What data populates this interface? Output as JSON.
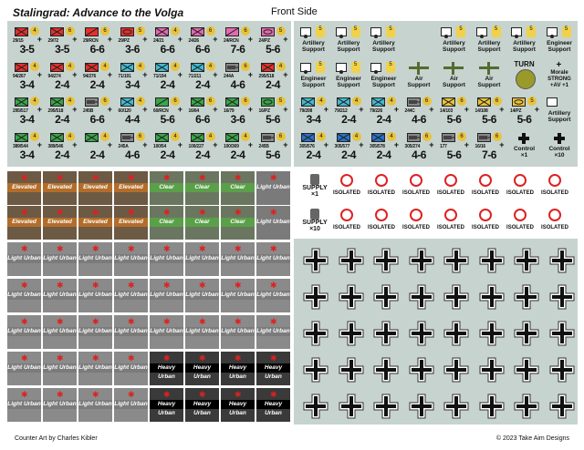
{
  "header": {
    "title": "Stalingrad: Advance to the Volga",
    "subtitle": "Front Side"
  },
  "footer": {
    "left": "Counter Art by Charles Kibler",
    "right": "© 2023 Take Aim Designs"
  },
  "colors": {
    "panel": "#c7d3cf",
    "red": "#e6302b",
    "green": "#3aa64a",
    "cyan": "#43bbd0",
    "pink": "#e46ab0",
    "tan": "#c9a45a",
    "grey": "#888888",
    "blue": "#2a72c8",
    "brown": "#b36d2a"
  },
  "units": [
    {
      "id": "29/15",
      "val": "3-5",
      "badge": "4",
      "color": "#e6302b",
      "sym": "inf"
    },
    {
      "id": "29/72",
      "val": "3-5",
      "badge": "6",
      "color": "#e6302b",
      "sym": "inf"
    },
    {
      "id": "29/RCN",
      "val": "6-6",
      "badge": "6",
      "color": "#e6302b",
      "sym": "rcn"
    },
    {
      "id": "29/PZ",
      "val": "3-6",
      "badge": "5",
      "color": "#e6302b",
      "sym": "arm"
    },
    {
      "id": "24/21",
      "val": "6-6",
      "badge": "4",
      "color": "#e46ab0",
      "sym": "inf"
    },
    {
      "id": "24/26",
      "val": "6-6",
      "badge": "6",
      "color": "#e46ab0",
      "sym": "inf"
    },
    {
      "id": "24/RCN",
      "val": "7-6",
      "badge": "6",
      "color": "#e46ab0",
      "sym": "rcn"
    },
    {
      "id": "24/PZ",
      "val": "5-6",
      "badge": "5",
      "color": "#e46ab0",
      "sym": "arm"
    },
    {
      "id": "94/267",
      "val": "3-4",
      "badge": "4",
      "color": "#e6302b",
      "sym": "inf"
    },
    {
      "id": "94/274",
      "val": "2-4",
      "badge": "4",
      "color": "#e6302b",
      "sym": "inf"
    },
    {
      "id": "94/276",
      "val": "2-4",
      "badge": "4",
      "color": "#e6302b",
      "sym": "inf"
    },
    {
      "id": "71/191",
      "val": "3-4",
      "badge": "4",
      "color": "#43bbd0",
      "sym": "inf"
    },
    {
      "id": "71/194",
      "val": "2-4",
      "badge": "4",
      "color": "#43bbd0",
      "sym": "inf"
    },
    {
      "id": "71/211",
      "val": "2-4",
      "badge": "4",
      "color": "#43bbd0",
      "sym": "inf"
    },
    {
      "id": "244A",
      "val": "4-6",
      "badge": "6",
      "color": "#888888",
      "sym": "gun"
    },
    {
      "id": "295/518",
      "val": "2-4",
      "badge": "4",
      "color": "#e6302b",
      "sym": "inf"
    },
    {
      "id": "295/517",
      "val": "3-4",
      "badge": "4",
      "color": "#3aa64a",
      "sym": "inf"
    },
    {
      "id": "295/518",
      "val": "2-4",
      "badge": "4",
      "color": "#3aa64a",
      "sym": "inf"
    },
    {
      "id": "245B",
      "val": "6-6",
      "badge": "6",
      "color": "#888888",
      "sym": "gun"
    },
    {
      "id": "60/120",
      "val": "4-4",
      "badge": "4",
      "color": "#43bbd0",
      "sym": "inf"
    },
    {
      "id": "60/RCN",
      "val": "5-6",
      "badge": "6",
      "color": "#3aa64a",
      "sym": "rcn"
    },
    {
      "id": "16/64",
      "val": "6-6",
      "badge": "6",
      "color": "#3aa64a",
      "sym": "inf"
    },
    {
      "id": "16/79",
      "val": "3-6",
      "badge": "6",
      "color": "#3aa64a",
      "sym": "inf"
    },
    {
      "id": "16/PZ",
      "val": "5-6",
      "badge": "5",
      "color": "#3aa64a",
      "sym": "arm"
    },
    {
      "id": "389/544",
      "val": "3-4",
      "badge": "4",
      "color": "#3aa64a",
      "sym": "inf"
    },
    {
      "id": "389/546",
      "val": "2-4",
      "badge": "4",
      "color": "#3aa64a",
      "sym": "inf"
    },
    {
      "id": "",
      "val": "2-4",
      "badge": "4",
      "color": "#3aa64a",
      "sym": "inf"
    },
    {
      "id": "245A",
      "val": "4-6",
      "badge": "6",
      "color": "#888888",
      "sym": "gun"
    },
    {
      "id": "100/54",
      "val": "2-4",
      "badge": "4",
      "color": "#3aa64a",
      "sym": "inf"
    },
    {
      "id": "100/227",
      "val": "2-4",
      "badge": "4",
      "color": "#3aa64a",
      "sym": "inf"
    },
    {
      "id": "100/369",
      "val": "2-4",
      "badge": "4",
      "color": "#3aa64a",
      "sym": "inf"
    },
    {
      "id": "245B",
      "val": "5-6",
      "badge": "6",
      "color": "#888888",
      "sym": "gun"
    }
  ],
  "units_right": [
    {
      "id": "79/208",
      "val": "3-4",
      "badge": "4",
      "color": "#43bbd0",
      "sym": "inf"
    },
    {
      "id": "79/212",
      "val": "2-4",
      "badge": "4",
      "color": "#43bbd0",
      "sym": "inf"
    },
    {
      "id": "79/226",
      "val": "2-4",
      "badge": "4",
      "color": "#43bbd0",
      "sym": "inf"
    },
    {
      "id": "244C",
      "val": "4-6",
      "badge": "6",
      "color": "#888888",
      "sym": "gun"
    },
    {
      "id": "14/103",
      "val": "5-6",
      "badge": "6",
      "color": "#e9c33a",
      "sym": "inf"
    },
    {
      "id": "14/108",
      "val": "5-6",
      "badge": "6",
      "color": "#e9c33a",
      "sym": "inf"
    },
    {
      "id": "14/PZ",
      "val": "5-6",
      "badge": "5",
      "color": "#e9c33a",
      "sym": "arm"
    },
    {
      "id": "305/576",
      "val": "2-4",
      "badge": "4",
      "color": "#2a72c8",
      "sym": "inf"
    },
    {
      "id": "305/577",
      "val": "2-4",
      "badge": "4",
      "color": "#2a72c8",
      "sym": "inf"
    },
    {
      "id": "305/578",
      "val": "2-4",
      "badge": "4",
      "color": "#2a72c8",
      "sym": "inf"
    },
    {
      "id": "305/274",
      "val": "4-6",
      "badge": "6",
      "color": "#888888",
      "sym": "gun"
    },
    {
      "id": "177",
      "val": "5-6",
      "badge": "6",
      "color": "#888888",
      "sym": "gun"
    },
    {
      "id": "16/16",
      "val": "7-6",
      "badge": "6",
      "color": "#888888",
      "sym": "gun"
    }
  ],
  "support_rows": [
    [
      "Artillery\nSupport",
      "Artillery\nSupport",
      "Artillery\nSupport",
      "",
      "Artillery\nSupport",
      "Artillery\nSupport",
      "Artillery\nSupport",
      "Engineer\nSupport"
    ],
    [
      "Engineer\nSupport",
      "Engineer\nSupport",
      "Engineer\nSupport",
      "Air\nSupport",
      "Air\nSupport",
      "Air\nSupport",
      "TURN",
      "Morale\nSTRONG\n+AV +1"
    ]
  ],
  "support_extra": [
    {
      "label": "Artillery\nSupport"
    },
    {
      "label": "Control\n×1"
    },
    {
      "label": "Control\n×10"
    }
  ],
  "terrain": {
    "elevated": [
      "Elevated",
      "Elevated",
      "Elevated",
      "Elevated"
    ],
    "clear": [
      "Clear",
      "Clear",
      "Clear"
    ],
    "light_urban": "Light Urban",
    "heavy_urban": "Heavy Urban"
  },
  "supply": {
    "one": "SUPPLY\n×1",
    "ten": "SUPPLY\n×10",
    "isolated": "ISOLATED"
  }
}
